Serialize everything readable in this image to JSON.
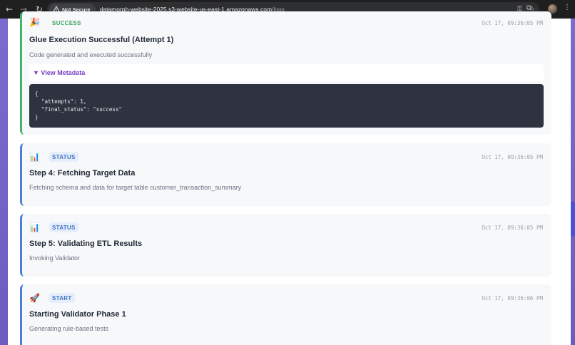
{
  "browser": {
    "security_label": "Not Secure",
    "url_host": "datamorph-website-2025.s3-website-us-east-1.amazonaws.com",
    "url_path": "/logs"
  },
  "logs": [
    {
      "type": "success",
      "icon": "party-popper-icon",
      "badge": "SUCCESS",
      "timestamp": "Oct 17, 09:36:05 PM",
      "title": "Glue Execution Successful (Attempt 1)",
      "description": "Code generated and executed successfully",
      "metadata_toggle": "▼ View Metadata",
      "metadata_lines": [
        "{",
        "  \"attempts\": 1,",
        "  \"final_status\": \"success\"",
        "}"
      ]
    },
    {
      "type": "status",
      "icon": "bar-chart-icon",
      "badge": "STATUS",
      "timestamp": "Oct 17, 09:36:05 PM",
      "title": "Step 4: Fetching Target Data",
      "description": "Fetching schema and data for target table customer_transaction_summary"
    },
    {
      "type": "status",
      "icon": "bar-chart-icon",
      "badge": "STATUS",
      "timestamp": "Oct 17, 09:36:05 PM",
      "title": "Step 5: Validating ETL Results",
      "description": "Invoking Validator"
    },
    {
      "type": "start",
      "icon": "rocket-icon",
      "badge": "START",
      "timestamp": "Oct 17, 09:36:06 PM",
      "title": "Starting Validator Phase 1",
      "description": "Generating rule-based tests"
    }
  ]
}
